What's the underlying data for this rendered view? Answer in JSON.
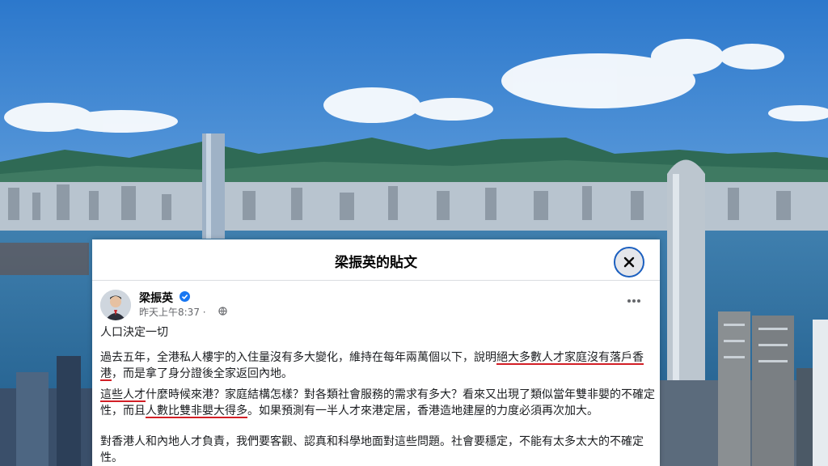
{
  "dialog": {
    "title": "梁振英的貼文",
    "close_icon": "close-icon"
  },
  "post": {
    "author": "梁振英",
    "timestamp": "昨天上午8:37 ·",
    "verified_icon": "verified-badge-icon",
    "audience_icon": "globe-icon",
    "more_icon": "more-options-icon",
    "paragraphs": {
      "p1": {
        "text": "人口決定一切"
      },
      "p2": {
        "a": "過去五年，全港私人樓宇的入住量沒有多大變化，維持在每年兩萬個以下，說明",
        "b": "絕大多數人才家庭沒有落戶香港",
        "c": "，而是拿了身分證後全家返回內地。"
      },
      "p3": {
        "a": "這些人才",
        "b": "什麼時候來港？家庭結構怎樣？對各類社會服務的需求有多大？看來又出現了類似當年雙非嬰的不確定性，而且",
        "c": "人數比雙非嬰大得多",
        "d": "。如果預測有一半人才來港定居，香港造地建屋的力度必須再次加大。"
      },
      "p4": {
        "text": "對香港人和內地人才負責，我們要客觀、認真和科學地面對這些問題。社會要穩定，不能有太多太大的不確定性。"
      }
    },
    "highlight_color": "#d21f26"
  },
  "background": {
    "sky_top": "#2f7fd0",
    "harbour": "#2e6f9e"
  }
}
